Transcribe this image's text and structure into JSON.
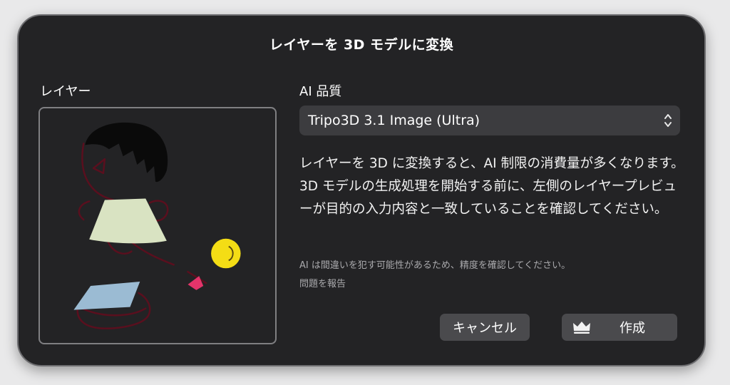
{
  "dialog": {
    "title": "レイヤーを 3D モデルに変換",
    "layer_label": "レイヤー",
    "quality_label": "AI 品質",
    "quality_selected": "Tripo3D 3.1 Image (Ultra)",
    "description": "レイヤーを 3D に変換すると、AI 制限の消費量が多くなります。3D モデルの生成処理を開始する前に、左側のレイヤープレビューが目的の入力内容と一致していることを確認してください。",
    "note_text": "AI は間違いを犯す可能性があるため、精度を確認してください。",
    "report_link": "問題を報告",
    "cancel_label": "キャンセル",
    "create_label": "作成"
  },
  "icons": {
    "select": "chevron-up-down-icon",
    "create": "crown-icon"
  },
  "colors": {
    "dialog_bg": "#232325",
    "control_bg": "#3c3c3f",
    "button_bg": "#4a4a4d",
    "preview_border": "#7f7f82"
  }
}
